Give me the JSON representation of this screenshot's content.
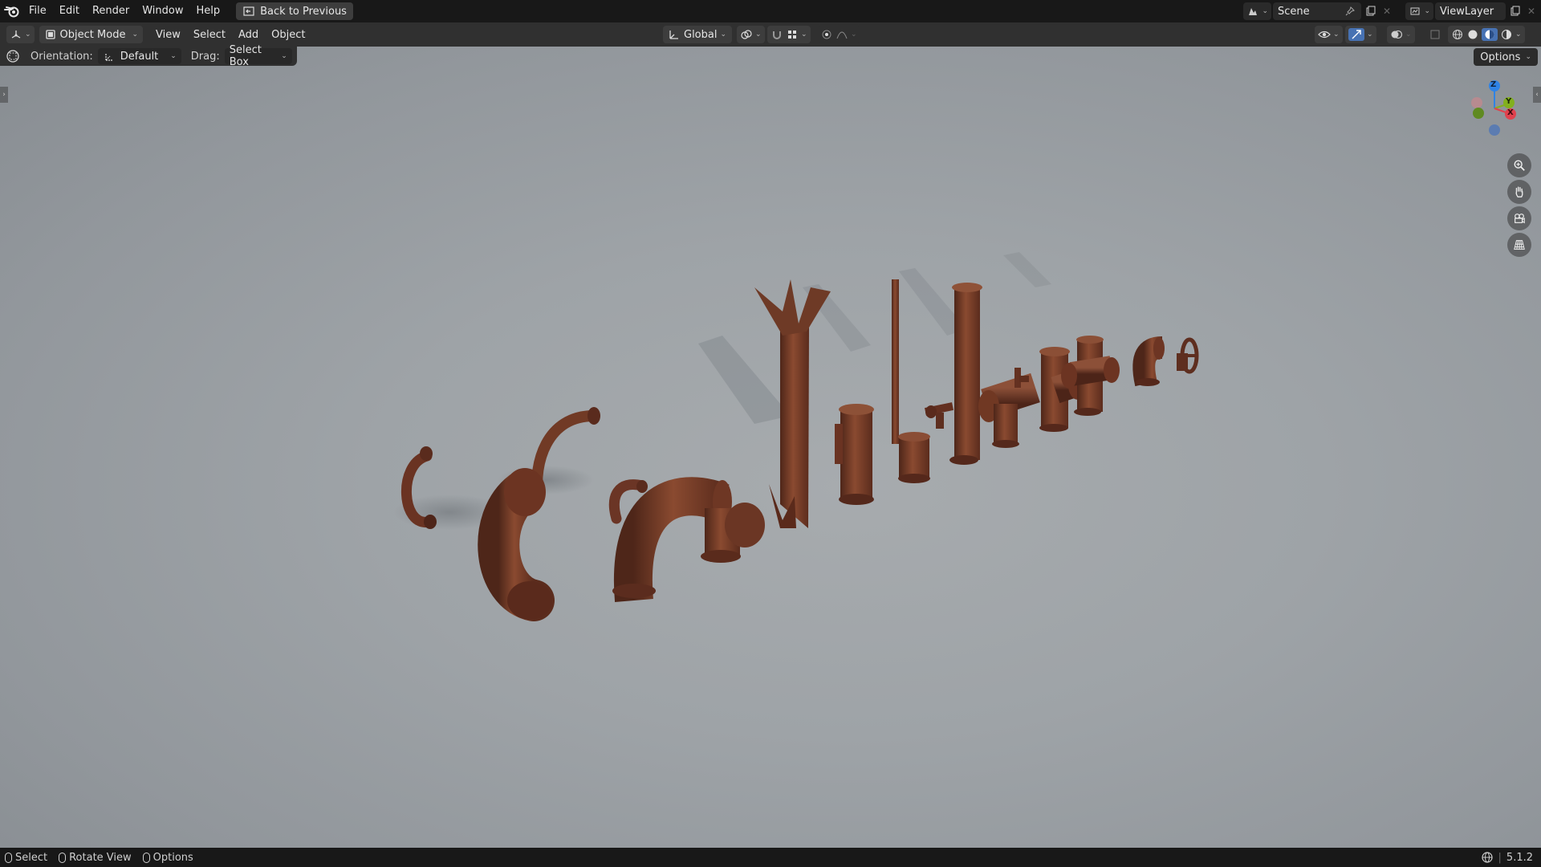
{
  "topbar": {
    "menus": [
      "File",
      "Edit",
      "Render",
      "Window",
      "Help"
    ],
    "back_label": "Back to Previous",
    "scene_label": "Scene",
    "viewlayer_label": "ViewLayer"
  },
  "header": {
    "mode_label": "Object Mode",
    "menus": [
      "View",
      "Select",
      "Add",
      "Object"
    ],
    "transform_orientation": "Global"
  },
  "tool_settings": {
    "orientation_label": "Orientation:",
    "orientation_value": "Default",
    "drag_label": "Drag:",
    "drag_value": "Select Box",
    "options_label": "Options"
  },
  "gizmo": {
    "axes": [
      "Z",
      "Y",
      "X"
    ],
    "colors": {
      "x": "#e0414d",
      "y": "#82b01e",
      "z": "#2f83e5"
    }
  },
  "statusbar": {
    "items": [
      "Select",
      "Rotate View",
      "Options"
    ],
    "version": "5.1.2"
  },
  "colors": {
    "topbar": "#181818",
    "header": "#303030",
    "accent_blue": "#4772b3",
    "rust": "#7a3e28"
  }
}
